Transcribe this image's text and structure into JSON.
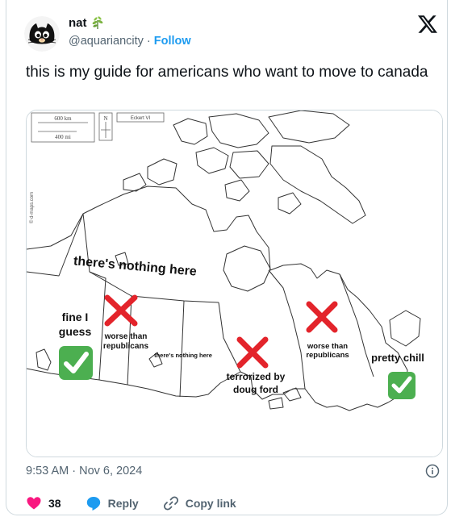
{
  "author": {
    "name": "nat",
    "handle": "@aquariancity",
    "separator": "·",
    "follow_label": "Follow"
  },
  "icons": {
    "badge": "herb-icon",
    "logo": "x-logo-icon",
    "info": "info-icon"
  },
  "tweet": {
    "text": "this is my guide for americans who want to move to canada"
  },
  "map": {
    "scale_km": "600 km",
    "scale_mi": "400 mi",
    "north": "N",
    "projection": "Eckert VI",
    "watermark": "© d-maps.com",
    "labels": {
      "nothing_here_big": "there's nothing here",
      "fine_line1": "fine I",
      "fine_line2": "guess",
      "worse1_line1": "worse than",
      "worse1_line2": "republicans",
      "nothing_here_small": "there's nothing here",
      "terrorized_line1": "terrorized by",
      "terrorized_line2": "doug ford",
      "worse2_line1": "worse than",
      "worse2_line2": "republicans",
      "pretty_chill": "pretty chill"
    },
    "colors": {
      "cross": "#e3242b",
      "check": "#4caf50"
    }
  },
  "timestamp": {
    "time": "9:53 AM",
    "separator": "·",
    "date": "Nov 6, 2024"
  },
  "actions": {
    "likes": "38",
    "reply_label": "Reply",
    "copy_label": "Copy link"
  },
  "colors": {
    "accent": "#1d9bf0",
    "like": "#f91880",
    "text_secondary": "#536471"
  }
}
